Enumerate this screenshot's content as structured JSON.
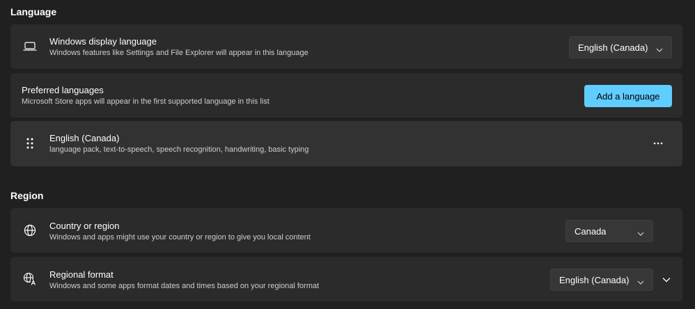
{
  "language": {
    "heading": "Language",
    "display_language": {
      "title": "Windows display language",
      "description": "Windows features like Settings and File Explorer will appear in this language",
      "selected": "English (Canada)",
      "icon": "laptop-icon"
    },
    "preferred_languages": {
      "title": "Preferred languages",
      "description": "Microsoft Store apps will appear in the first supported language in this list",
      "add_button": "Add a language"
    },
    "languages": [
      {
        "name": "English (Canada)",
        "features": "language pack, text-to-speech, speech recognition, handwriting, basic typing",
        "icon": "drag-handle-icon"
      }
    ]
  },
  "region": {
    "heading": "Region",
    "country": {
      "title": "Country or region",
      "description": "Windows and apps might use your country or region to give you local content",
      "selected": "Canada",
      "icon": "globe-icon"
    },
    "regional_format": {
      "title": "Regional format",
      "description": "Windows and some apps format dates and times based on your regional format",
      "selected": "English (Canada)",
      "icon": "language-format-icon"
    }
  },
  "colors": {
    "accent": "#60cdff",
    "background": "#202020",
    "card": "#2b2b2b"
  }
}
